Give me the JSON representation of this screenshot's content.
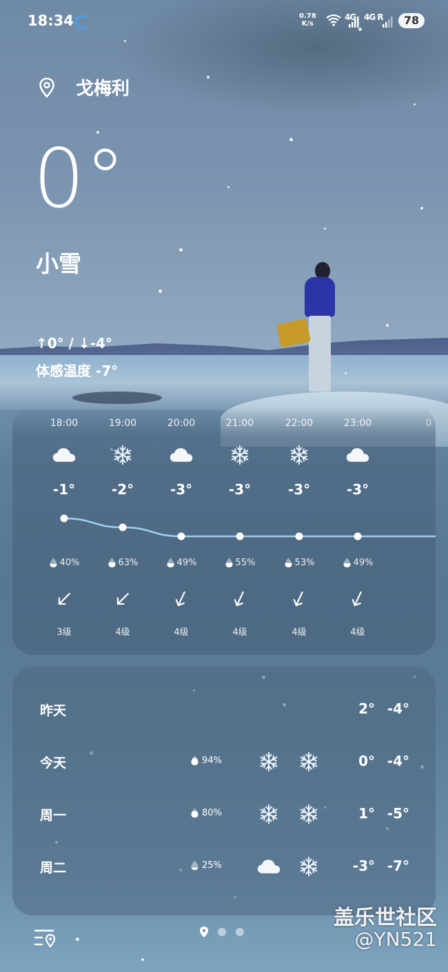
{
  "status_bar": {
    "time": "18:34",
    "net_speed_value": "0.78",
    "net_speed_unit": "K/s",
    "sig1": "4G",
    "sig2": "4G R",
    "battery": "78"
  },
  "location": {
    "name": "戈梅利"
  },
  "current": {
    "temperature": "0°",
    "condition": "小雪",
    "high_low": "↑0° / ↓-4°",
    "feels_like": "体感温度 -7°"
  },
  "hourly": [
    {
      "time": "18:00",
      "icon": "cloud-icon",
      "temp": "-1°",
      "temp_value": -1,
      "rain": "40%",
      "wind_dir": "southeast",
      "wind": "3级"
    },
    {
      "time": "19:00",
      "icon": "snowflake-icon",
      "temp": "-2°",
      "temp_value": -2,
      "rain": "63%",
      "wind_dir": "southeast",
      "wind": "4级"
    },
    {
      "time": "20:00",
      "icon": "cloud-icon",
      "temp": "-3°",
      "temp_value": -3,
      "rain": "49%",
      "wind_dir": "south-southeast",
      "wind": "4级"
    },
    {
      "time": "21:00",
      "icon": "snowflake-icon",
      "temp": "-3°",
      "temp_value": -3,
      "rain": "55%",
      "wind_dir": "south-southeast",
      "wind": "4级"
    },
    {
      "time": "22:00",
      "icon": "snowflake-icon",
      "temp": "-3°",
      "temp_value": -3,
      "rain": "53%",
      "wind_dir": "south-southeast",
      "wind": "4级"
    },
    {
      "time": "23:00",
      "icon": "cloud-icon",
      "temp": "-3°",
      "temp_value": -3,
      "rain": "49%",
      "wind_dir": "south-southeast",
      "wind": "4级"
    }
  ],
  "daily": [
    {
      "day": "昨天",
      "rain": "",
      "icon1": "",
      "icon2": "",
      "high": "2°",
      "low": "-4°"
    },
    {
      "day": "今天",
      "rain": "94%",
      "icon1": "snowflake-icon",
      "icon2": "snowflake-icon",
      "high": "0°",
      "low": "-4°"
    },
    {
      "day": "周一",
      "rain": "80%",
      "icon1": "snowflake-icon",
      "icon2": "snowflake-icon",
      "high": "1°",
      "low": "-5°"
    },
    {
      "day": "周二",
      "rain": "25%",
      "icon1": "cloud-icon",
      "icon2": "snowflake-icon",
      "high": "-3°",
      "low": "-7°"
    }
  ],
  "watermark": {
    "line1": "盖乐世社区",
    "line2": "@YN521"
  },
  "colors": {
    "curve": "#9fd0f5",
    "card": "#4e6880",
    "accent_spinner": "#4aa0e8"
  }
}
